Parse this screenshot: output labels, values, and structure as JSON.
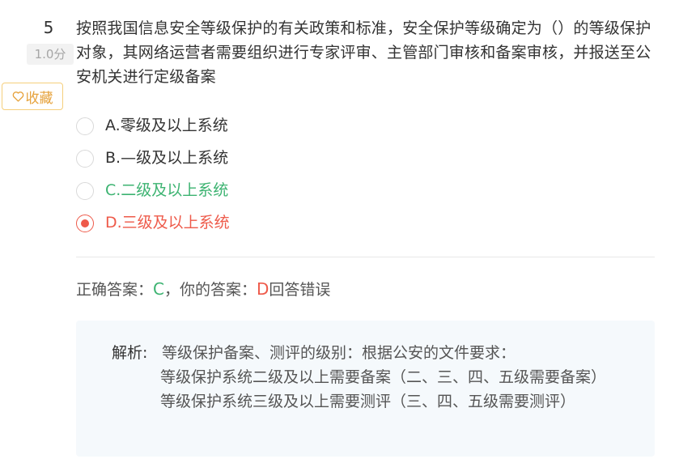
{
  "question": {
    "number": "5",
    "score": "1.0分",
    "favorite_label": "收藏",
    "text": "按照我国信息安全等级保护的有关政策和标准，安全保护等级确定为（）的等级保护对象，其网络运营者需要组织进行专家评审、主管部门审核和备案审核，并报送至公安机关进行定级备案",
    "options": [
      {
        "text": "A.零级及以上系统",
        "state": "normal"
      },
      {
        "text": "B.—级及以上系统",
        "state": "normal"
      },
      {
        "text": "C.二级及以上系统",
        "state": "correct"
      },
      {
        "text": "D.三级及以上系统",
        "state": "selected-wrong"
      }
    ]
  },
  "result": {
    "correct_label": "正确答案：",
    "correct_value": "C",
    "separator": "，",
    "your_label": "你的答案：",
    "your_value": "D",
    "status": "回答错误"
  },
  "analysis": {
    "label": "解析:",
    "line1": "等级保护备案、测评的级别：根据公安的文件要求：",
    "body": "等级保护系统二级及以上需要备案（二、三、四、五级需要备案）\n等级保护系统三级及以上需要测评（三、四、五级需要测评）"
  },
  "colors": {
    "correct": "#3cb371",
    "wrong": "#ee5a4a",
    "favorite": "#e6a23c",
    "analysis_bg": "#f5f9fc"
  },
  "icons": {
    "favorite": "heart-outline-icon"
  }
}
